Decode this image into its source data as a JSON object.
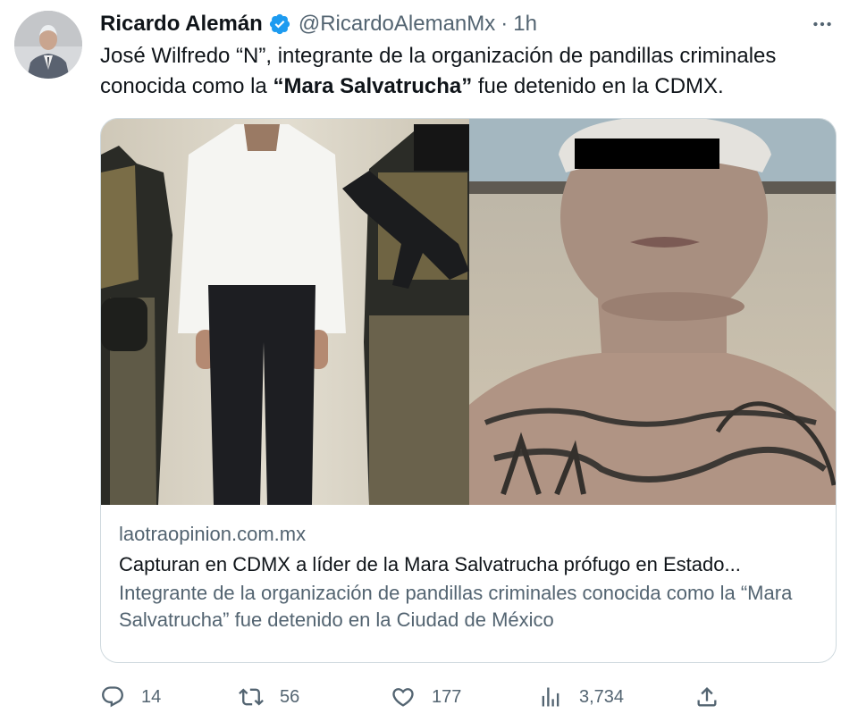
{
  "tweet": {
    "author_name": "Ricardo Alemán",
    "handle": "@RicardoAlemanMx",
    "separator": "·",
    "time": "1h",
    "text_part1": "José Wilfredo “N”, integrante de la organización de pandillas criminales conocida como la ",
    "text_bold": "“Mara Salvatrucha”",
    "text_part2": " fue detenido en la CDMX."
  },
  "card": {
    "domain": "laotraopinion.com.mx",
    "title": "Capturan en CDMX a líder de la Mara Salvatrucha prófugo en Estado...",
    "description": "Integrante de la organización de pandillas criminales conocida como la “Mara Salvatrucha” fue detenido en la Ciudad de México"
  },
  "actions": {
    "replies": "14",
    "retweets": "56",
    "likes": "177",
    "views": "3,734"
  },
  "colors": {
    "text": "#0f1419",
    "secondary": "#536471",
    "verified": "#1d9bf0",
    "border": "#cfd9de"
  },
  "icons": [
    "verified-icon",
    "more-icon",
    "reply-icon",
    "retweet-icon",
    "like-icon",
    "views-icon",
    "share-icon"
  ]
}
